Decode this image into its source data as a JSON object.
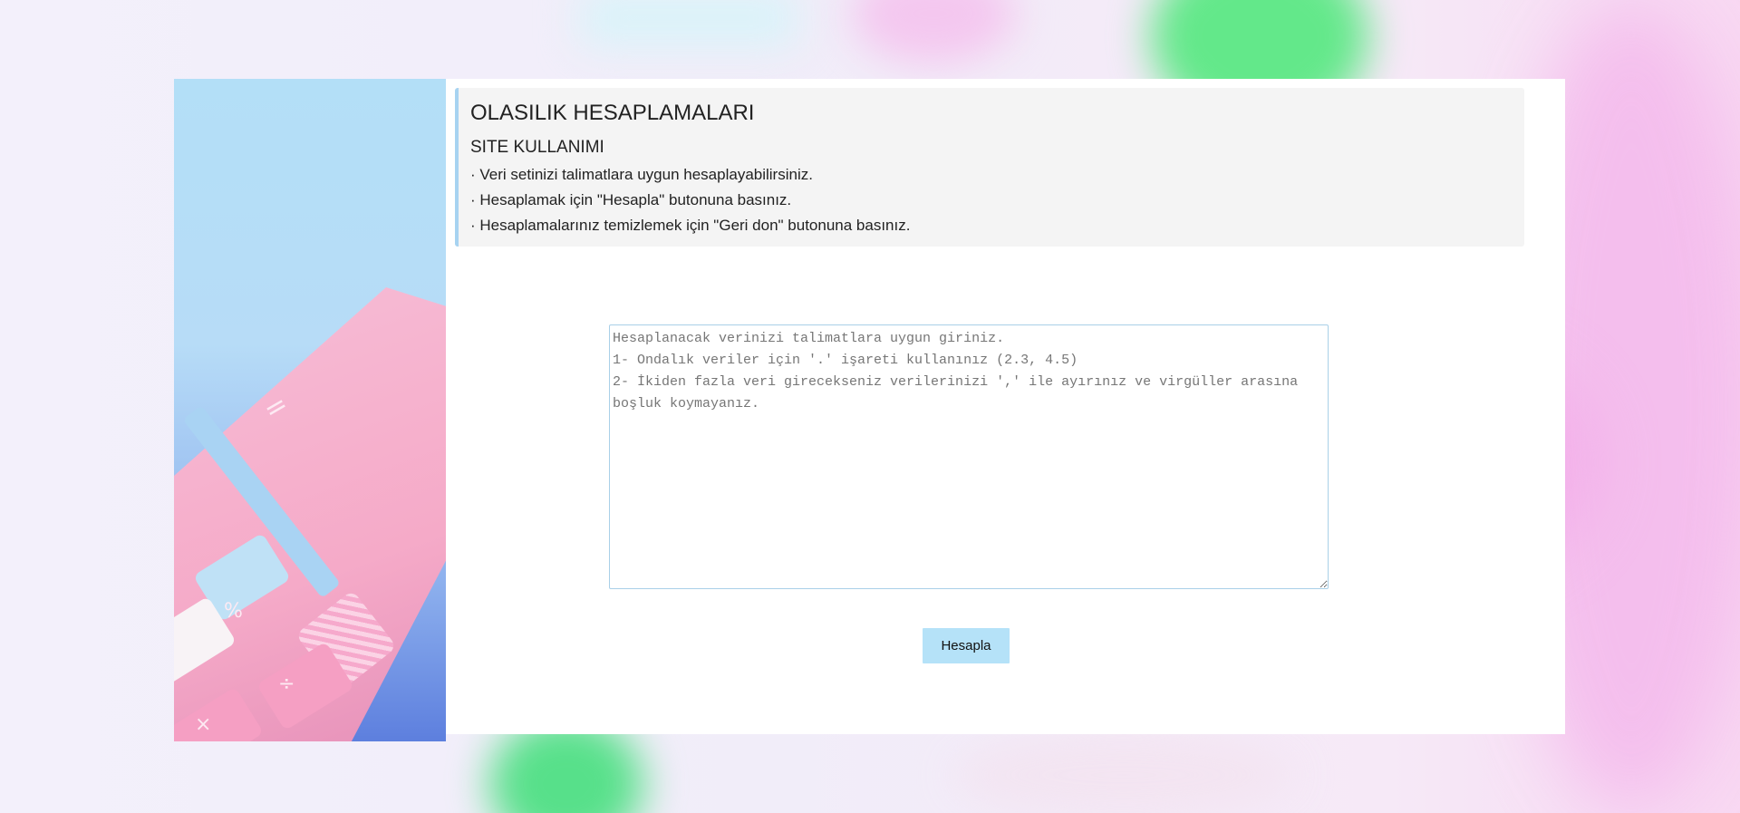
{
  "info": {
    "title": "OLASILIK HESAPLAMALARI",
    "subtitle": "SITE KULLANIMI",
    "lines": [
      "· Veri setinizi talimatlara uygun hesaplayabilirsiniz.",
      "· Hesaplamak için \"Hesapla\" butonuna basınız.",
      "· Hesaplamalarınız temizlemek için \"Geri don\" butonuna basınız."
    ]
  },
  "input": {
    "value": "",
    "placeholder": "Hesaplanacak verinizi talimatlara uygun giriniz.\n1- Ondalık veriler için '.' işareti kullanınız (2.3, 4.5)\n2- İkiden fazla veri girecekseniz verilerinizi ',' ile ayırınız ve virgüller arasına boşluk koymayanız."
  },
  "button": {
    "label": "Hesapla"
  },
  "illustration": {
    "keys": [
      "%",
      "÷",
      "×",
      "="
    ]
  },
  "colors": {
    "accent": "#a7d3f1",
    "button": "#b5e2f8",
    "info_bg": "#f4f4f4"
  }
}
